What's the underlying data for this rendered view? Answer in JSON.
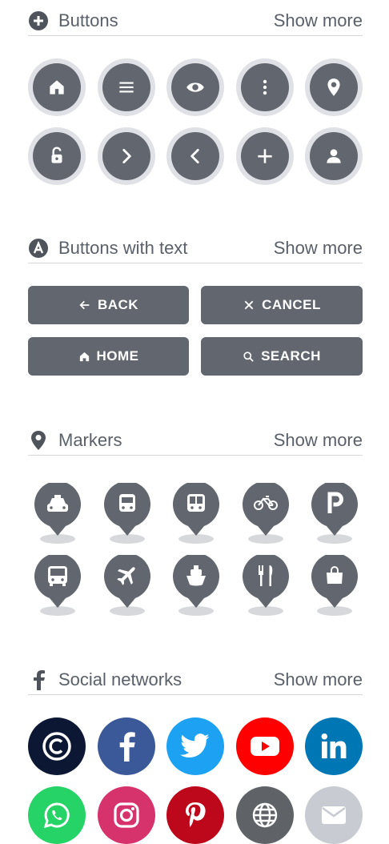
{
  "sections": {
    "buttons": {
      "title": "Buttons",
      "show_more": "Show more"
    },
    "buttons_text": {
      "title": "Buttons with text",
      "show_more": "Show more"
    },
    "markers": {
      "title": "Markers",
      "show_more": "Show more"
    },
    "social": {
      "title": "Social networks",
      "show_more": "Show more"
    }
  },
  "text_buttons": {
    "back": "BACK",
    "cancel": "CANCEL",
    "home": "HOME",
    "search": "SEARCH"
  },
  "icons": {
    "buttons": [
      "home-icon",
      "menu-icon",
      "eye-icon",
      "more-vertical-icon",
      "location-pin-icon",
      "unlock-icon",
      "chevron-right-icon",
      "chevron-left-icon",
      "plus-icon",
      "user-icon"
    ],
    "markers": [
      "taxi-icon",
      "train-icon",
      "bus-front-icon",
      "bicycle-icon",
      "parking-icon",
      "bus-icon",
      "airplane-icon",
      "ferry-icon",
      "restaurant-icon",
      "shopping-bag-icon"
    ],
    "social": [
      "copyright-icon",
      "facebook-icon",
      "twitter-icon",
      "youtube-icon",
      "linkedin-icon",
      "whatsapp-icon",
      "instagram-icon",
      "pinterest-icon",
      "globe-icon",
      "email-icon"
    ]
  },
  "colors": {
    "button_fill": "#62666e",
    "button_ring": "#dfe1e6",
    "marker_fill": "#62666e",
    "facebook": "#3b5998",
    "twitter": "#1da1f2",
    "youtube": "#ff0000",
    "linkedin": "#0077b5",
    "whatsapp": "#25d366",
    "instagram": "#d6336c",
    "pinterest": "#bd081c",
    "globe": "#5f6368",
    "email": "#c8cbd1",
    "copyright": "#0b1733"
  }
}
